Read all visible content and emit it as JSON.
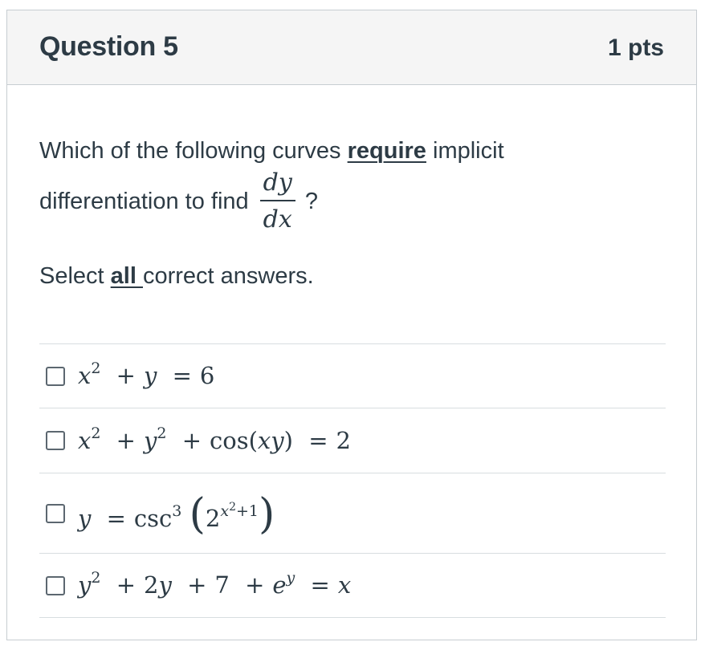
{
  "question": {
    "title": "Question 5",
    "points": "1 pts"
  },
  "prompt": {
    "line1_before": "Which of the following curves ",
    "line1_emphasis": "require",
    "line1_after": " implicit",
    "line2_text": "differentiation to find",
    "fraction_numerator": "dy",
    "fraction_denominator": "dx",
    "line2_end": "?",
    "line3_before": "Select ",
    "line3_emphasis": "all ",
    "line3_after": "correct answers."
  },
  "answers": [
    {
      "id": "a1",
      "checked": false,
      "latex": "x^2 + y = 6"
    },
    {
      "id": "a2",
      "checked": false,
      "latex": "x^2 + y^2 + \\cos(xy) = 2"
    },
    {
      "id": "a3",
      "checked": false,
      "latex": "y = \\csc^3\\left(2^{x^2+1}\\right)"
    },
    {
      "id": "a4",
      "checked": false,
      "latex": "y^2 + 2y + 7 + e^y = x"
    }
  ],
  "math_tokens": {
    "x": "x",
    "y": "y",
    "e": "e",
    "two": "2",
    "three": "3",
    "six": "6",
    "seven": "7",
    "one": "1",
    "plus": "+",
    "equals": "=",
    "cos": "cos",
    "csc": "csc",
    "lparen": "(",
    "rparen": ")"
  },
  "colors": {
    "text": "#2d3b45",
    "header_bg": "#f5f5f5",
    "border": "#c7cdd1",
    "divider": "#d8dde0"
  }
}
